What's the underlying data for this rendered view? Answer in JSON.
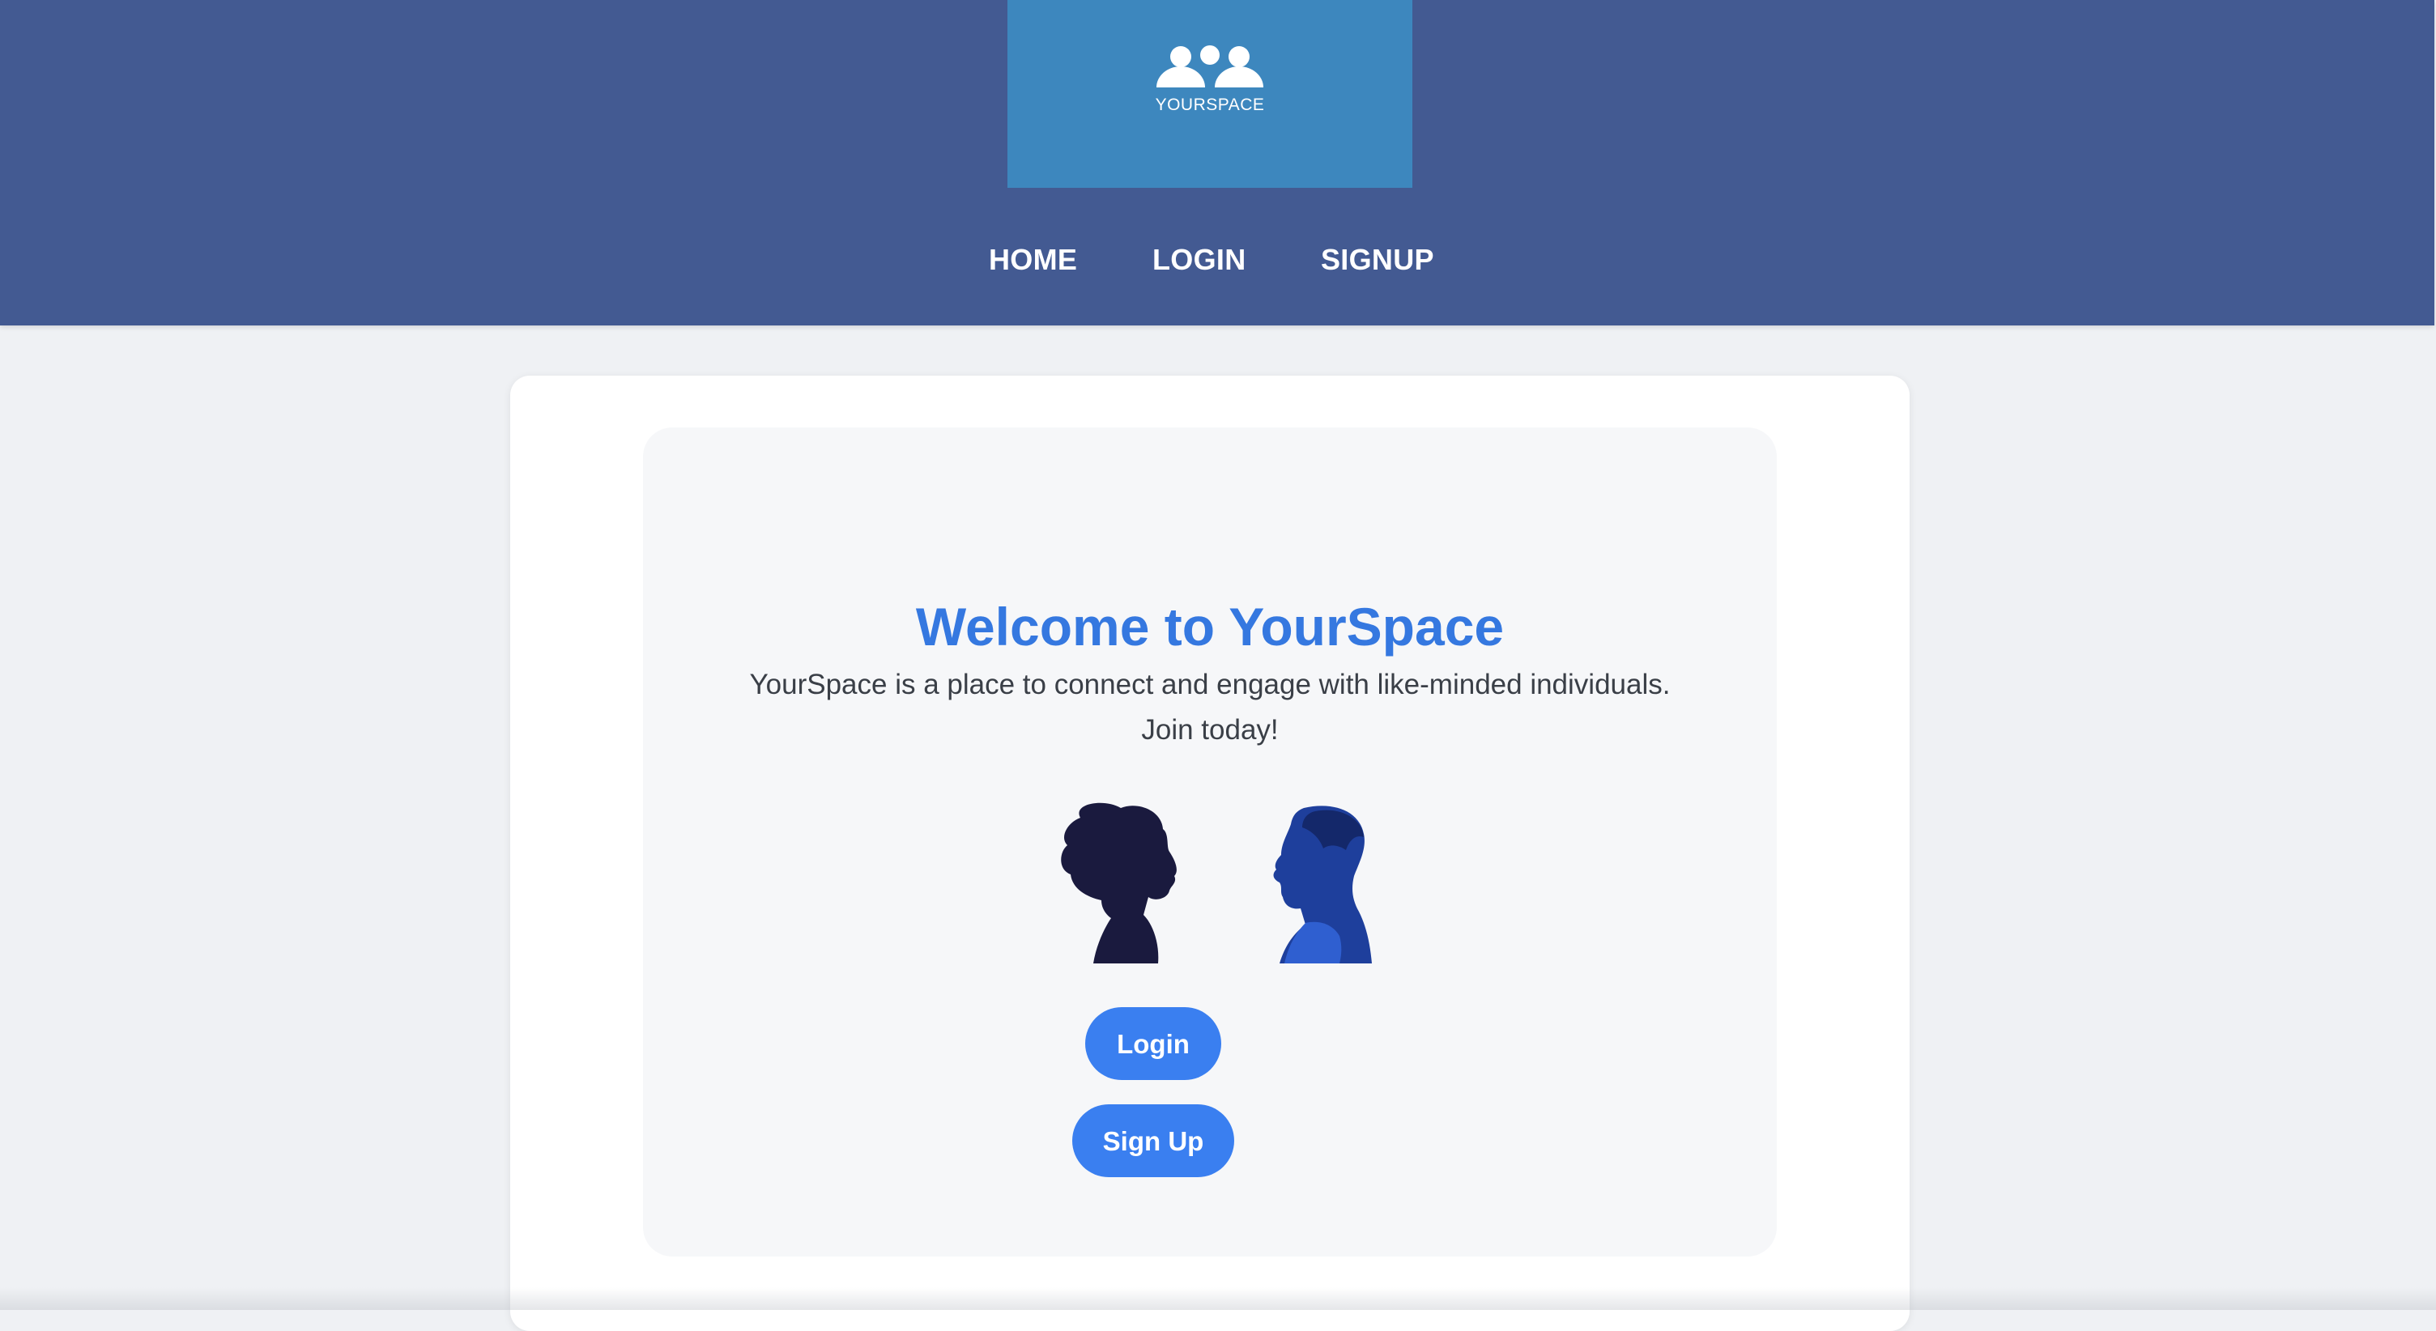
{
  "logo": {
    "icon": "users-group-icon",
    "text": "YOURSPACE"
  },
  "nav": {
    "items": [
      {
        "label": "HOME"
      },
      {
        "label": "LOGIN"
      },
      {
        "label": "SIGNUP"
      }
    ]
  },
  "hero": {
    "title": "Welcome to YourSpace",
    "description_line1": "YourSpace is a place to connect and engage with like-minded individuals.",
    "description_line2": "Join today!",
    "illustration": "two-profile-silhouettes"
  },
  "buttons": {
    "login": "Login",
    "signup": "Sign Up"
  },
  "colors": {
    "header_bg": "#435a92",
    "logo_bg": "#3d87be",
    "accent": "#3578e0",
    "button_bg": "#3a7ff0",
    "page_bg": "#eff1f4"
  }
}
